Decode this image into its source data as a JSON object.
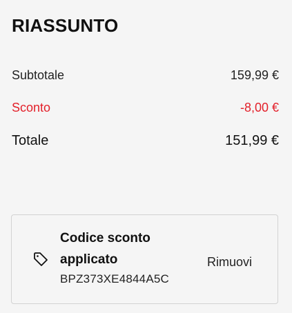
{
  "summary": {
    "title": "RIASSUNTO",
    "subtotal": {
      "label": "Subtotale",
      "value": "159,99 €"
    },
    "discount": {
      "label": "Sconto",
      "value": "-8,00 €"
    },
    "total": {
      "label": "Totale",
      "value": "151,99 €"
    }
  },
  "coupon": {
    "icon": "tag-icon",
    "title": "Codice sconto applicato",
    "code": "BPZ373XE4844A5C",
    "remove_label": "Rimuovi"
  },
  "colors": {
    "discount": "#e3202a",
    "background": "#f5f5f5",
    "border": "#d2d2d2"
  }
}
